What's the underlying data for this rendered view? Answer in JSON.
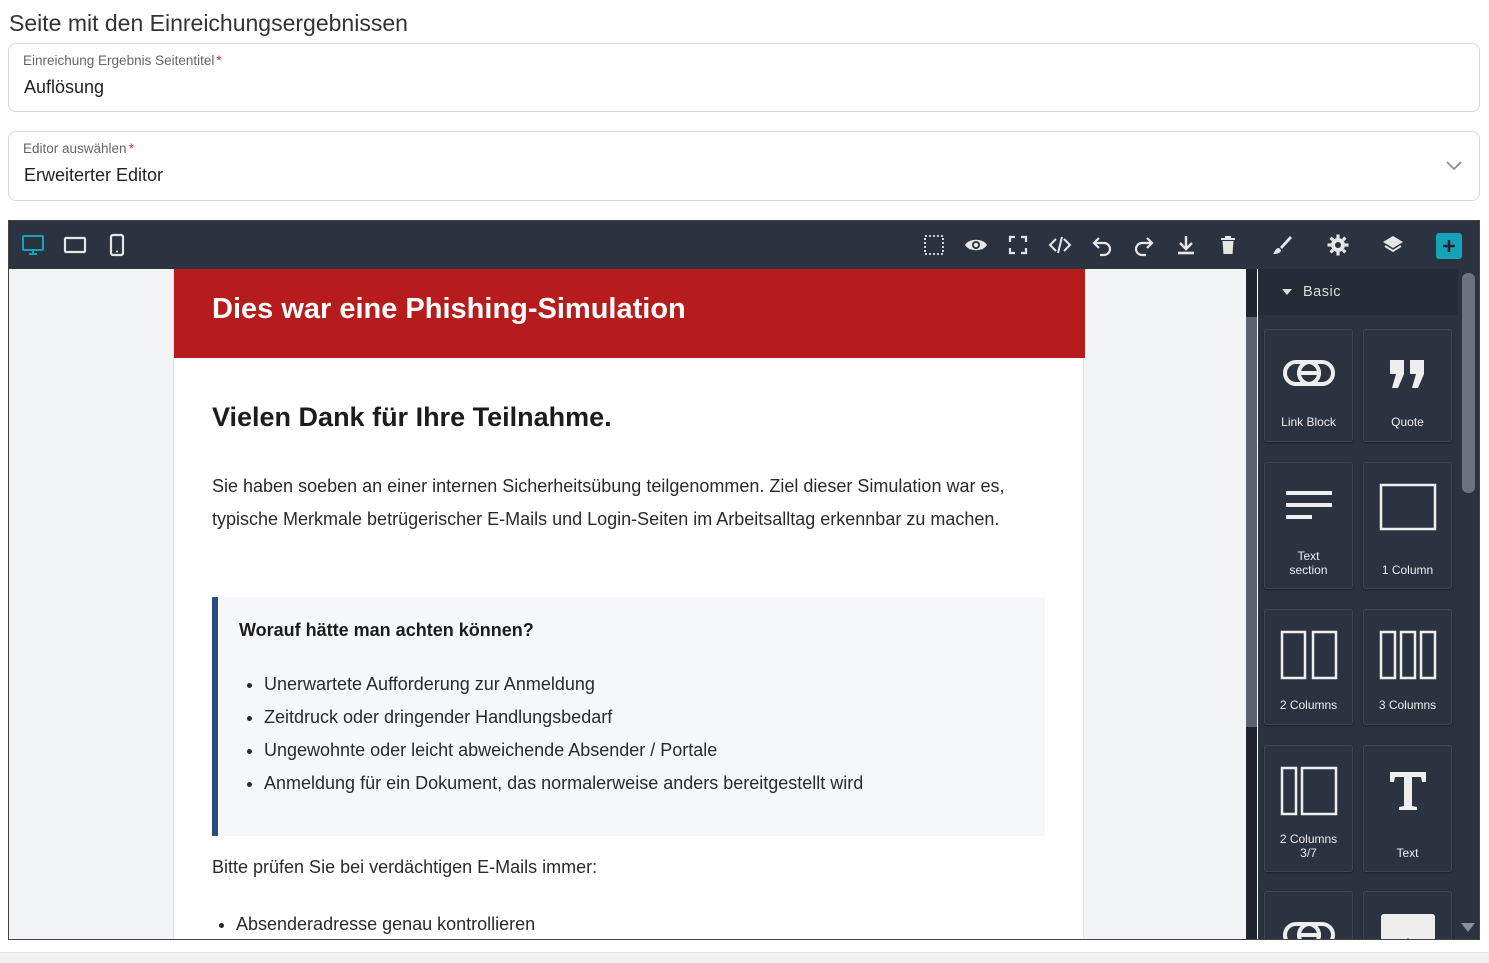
{
  "page": {
    "title": "Seite mit den Einreichungsergebnissen"
  },
  "form": {
    "result_title": {
      "label": "Einreichung Ergebnis Seitentitel",
      "required_mark": "*",
      "value": "Auflösung"
    },
    "editor_select": {
      "label": "Editor auswählen",
      "required_mark": "*",
      "value": "Erweiterter Editor"
    }
  },
  "toolbar": {
    "devices": [
      "desktop-icon",
      "tablet-icon",
      "mobile-icon"
    ],
    "actions": [
      "select-outline-icon",
      "preview-eye-icon",
      "fullscreen-icon",
      "code-icon",
      "undo-icon",
      "redo-icon",
      "download-icon",
      "delete-icon"
    ],
    "panels": [
      "style-brush-icon",
      "settings-gear-icon",
      "layers-icon",
      "add-block-icon"
    ],
    "accent_color": "#17a2b8"
  },
  "document": {
    "banner_title": "Dies war eine Phishing-Simulation",
    "heading": "Vielen Dank für Ihre Teilnahme.",
    "intro": "Sie haben soeben an einer internen Sicherheitsübung teilgenommen. Ziel dieser Simulation war es, typische Merkmale betrügerischer E-Mails und Login-Seiten im Arbeitsalltag erkennbar zu machen.",
    "callout_title": "Worauf hätte man achten können?",
    "callout_items": [
      "Unerwartete Aufforderung zur Anmeldung",
      "Zeitdruck oder dringender Handlungsbedarf",
      "Ungewohnte oder leicht abweichende Absender / Portale",
      "Anmeldung für ein Dokument, das normalerweise anders bereitgestellt wird"
    ],
    "check_intro": "Bitte prüfen Sie bei verdächtigen E-Mails immer:",
    "check_items": [
      "Absenderadresse genau kontrollieren"
    ],
    "banner_color": "#b71c1c",
    "callout_border_color": "#2b4c7e"
  },
  "blocks_panel": {
    "category": "Basic",
    "blocks": [
      {
        "label": "Link Block",
        "icon": "link-icon"
      },
      {
        "label": "Quote",
        "icon": "quote-icon"
      },
      {
        "label": "Text\nsection",
        "icon": "text-section-icon"
      },
      {
        "label": "1 Column",
        "icon": "one-column-icon"
      },
      {
        "label": "2 Columns",
        "icon": "two-columns-icon"
      },
      {
        "label": "3 Columns",
        "icon": "three-columns-icon"
      },
      {
        "label": "2 Columns\n3/7",
        "icon": "two-columns-37-icon"
      },
      {
        "label": "Text",
        "icon": "text-icon"
      },
      {
        "label": "",
        "icon": "link-icon"
      },
      {
        "label": "",
        "icon": "image-icon"
      }
    ]
  }
}
